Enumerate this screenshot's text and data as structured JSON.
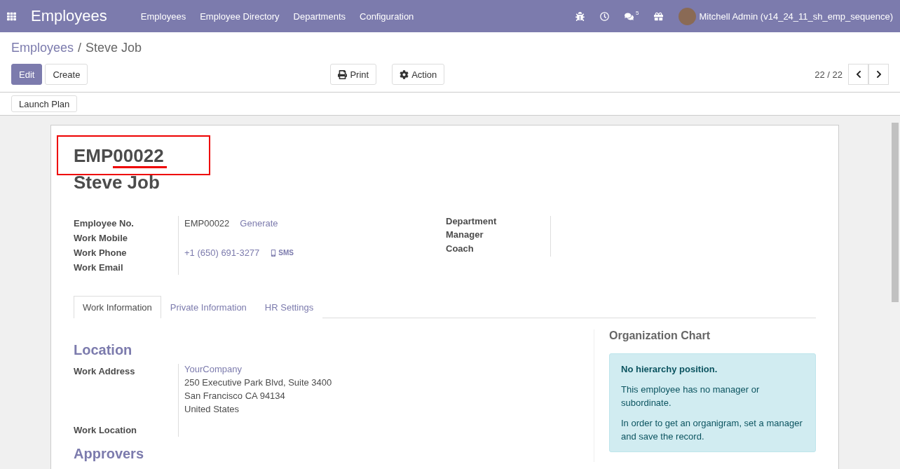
{
  "navbar": {
    "app_title": "Employees",
    "menu": [
      "Employees",
      "Employee Directory",
      "Departments",
      "Configuration"
    ],
    "message_count": "5",
    "user": "Mitchell Admin (v14_24_11_sh_emp_sequence)"
  },
  "breadcrumb": {
    "parent": "Employees",
    "separator": "/",
    "current": "Steve Job"
  },
  "buttons": {
    "edit": "Edit",
    "create": "Create",
    "print": "Print",
    "action": "Action"
  },
  "pager": "22 / 22",
  "header_buttons": [
    "Launch Plan"
  ],
  "sheet": {
    "sequence": "EMP00022",
    "name": "Steve Job",
    "left_fields": [
      {
        "label": "Employee No.",
        "kind": "code",
        "value": "EMP00022",
        "action": "Generate"
      },
      {
        "label": "Work Mobile",
        "kind": "empty"
      },
      {
        "label": "Work Phone",
        "kind": "phone",
        "value": "+1 (650) 691-3277",
        "action": "SMS"
      },
      {
        "label": "Work Email",
        "kind": "empty"
      }
    ],
    "right_fields": [
      {
        "label": "Department"
      },
      {
        "label": "Manager"
      },
      {
        "label": "Coach"
      }
    ],
    "tabs": [
      {
        "label": "Work Information",
        "selected": true
      },
      {
        "label": "Private Information",
        "selected": false
      },
      {
        "label": "HR Settings",
        "selected": false
      }
    ],
    "location": {
      "title": "Location",
      "address_label": "Work Address",
      "company": "YourCompany",
      "address_lines": [
        "250 Executive Park Blvd, Suite 3400",
        "San Francisco CA 94134",
        "United States"
      ],
      "location_label": "Work Location"
    },
    "next_section": "Approvers",
    "org_chart": {
      "title": "Organization Chart",
      "heading": "No hierarchy position.",
      "paragraphs": [
        "This employee has no manager or subordinate.",
        "In order to get an organigram, set a manager and save the record."
      ]
    }
  }
}
